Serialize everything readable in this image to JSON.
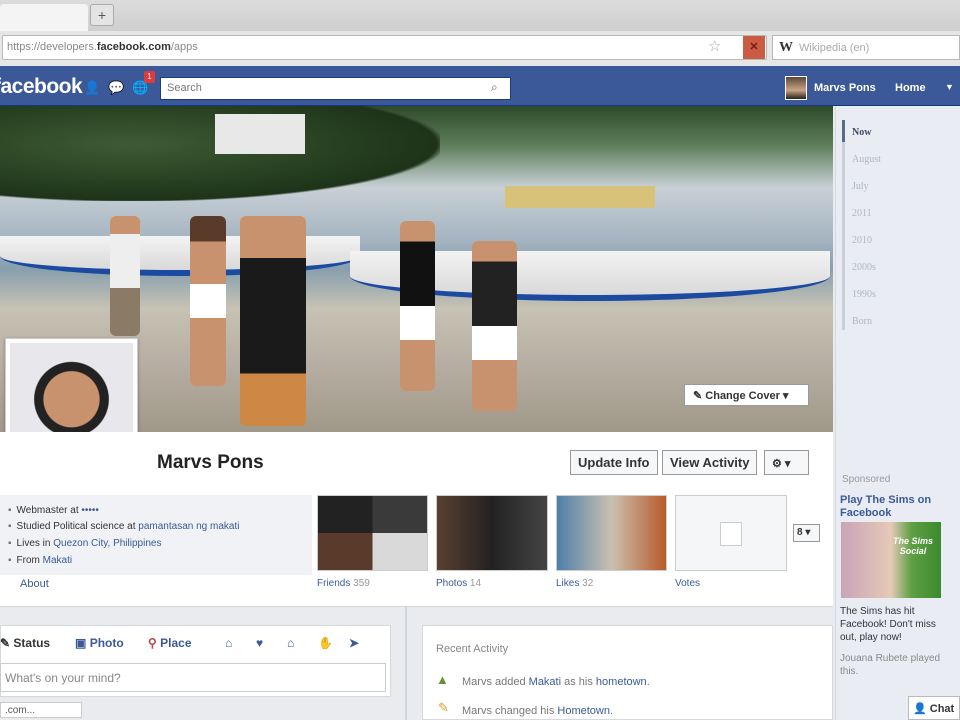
{
  "browser": {
    "new_tab": "+",
    "url_prefix": "https://developers.",
    "url_domain": "facebook.com",
    "url_path": "/apps",
    "search_engine": "W",
    "search_placeholder": "Wikipedia (en)"
  },
  "header": {
    "logo": "facebook",
    "notification_count": "1",
    "search_placeholder": "Search",
    "user_name": "Marvs Pons",
    "home": "Home"
  },
  "profile": {
    "name": "Marvs Pons",
    "change_cover": "Change Cover",
    "update_info": "Update Info",
    "view_activity": "View Activity",
    "settings": "⚙ ▾"
  },
  "info": [
    {
      "text": "Webmaster at ",
      "link": "•••••"
    },
    {
      "text": "Studied Political science at ",
      "link": "pamantasan ng makati"
    },
    {
      "text": "Lives in ",
      "link": "Quezon City, Philippines"
    },
    {
      "text": "From ",
      "link": "Makati"
    }
  ],
  "about": "About",
  "sections": [
    {
      "label": "Friends",
      "count": "359"
    },
    {
      "label": "Photos",
      "count": "14"
    },
    {
      "label": "Likes",
      "count": "32"
    },
    {
      "label": "Votes",
      "count": ""
    }
  ],
  "sections_more": "8 ▾",
  "composer": {
    "status": "Status",
    "photo": "Photo",
    "place": "Place",
    "placeholder": "What's on your mind?",
    "stub": ".com..."
  },
  "recent": {
    "title": "Recent Activity",
    "rows": [
      {
        "pre": "Marvs added ",
        "link1": "Makati",
        "mid": " as his ",
        "link2": "hometown",
        "post": "."
      },
      {
        "pre": "Marvs changed his ",
        "link1": "Hometown",
        "mid": "",
        "link2": "",
        "post": "."
      }
    ]
  },
  "timeline": [
    "Now",
    "August",
    "July",
    "2011",
    "2010",
    "2000s",
    "1990s",
    "Born"
  ],
  "ad": {
    "sponsored": "Sponsored",
    "title": "Play The Sims on Facebook",
    "image_text": "The Sims Social",
    "text": "The Sims has hit Facebook! Don't miss out, play now!",
    "social": "Jouana Rubete played this."
  },
  "chat": "Chat",
  "colors": {
    "brand": "#3b5998"
  }
}
